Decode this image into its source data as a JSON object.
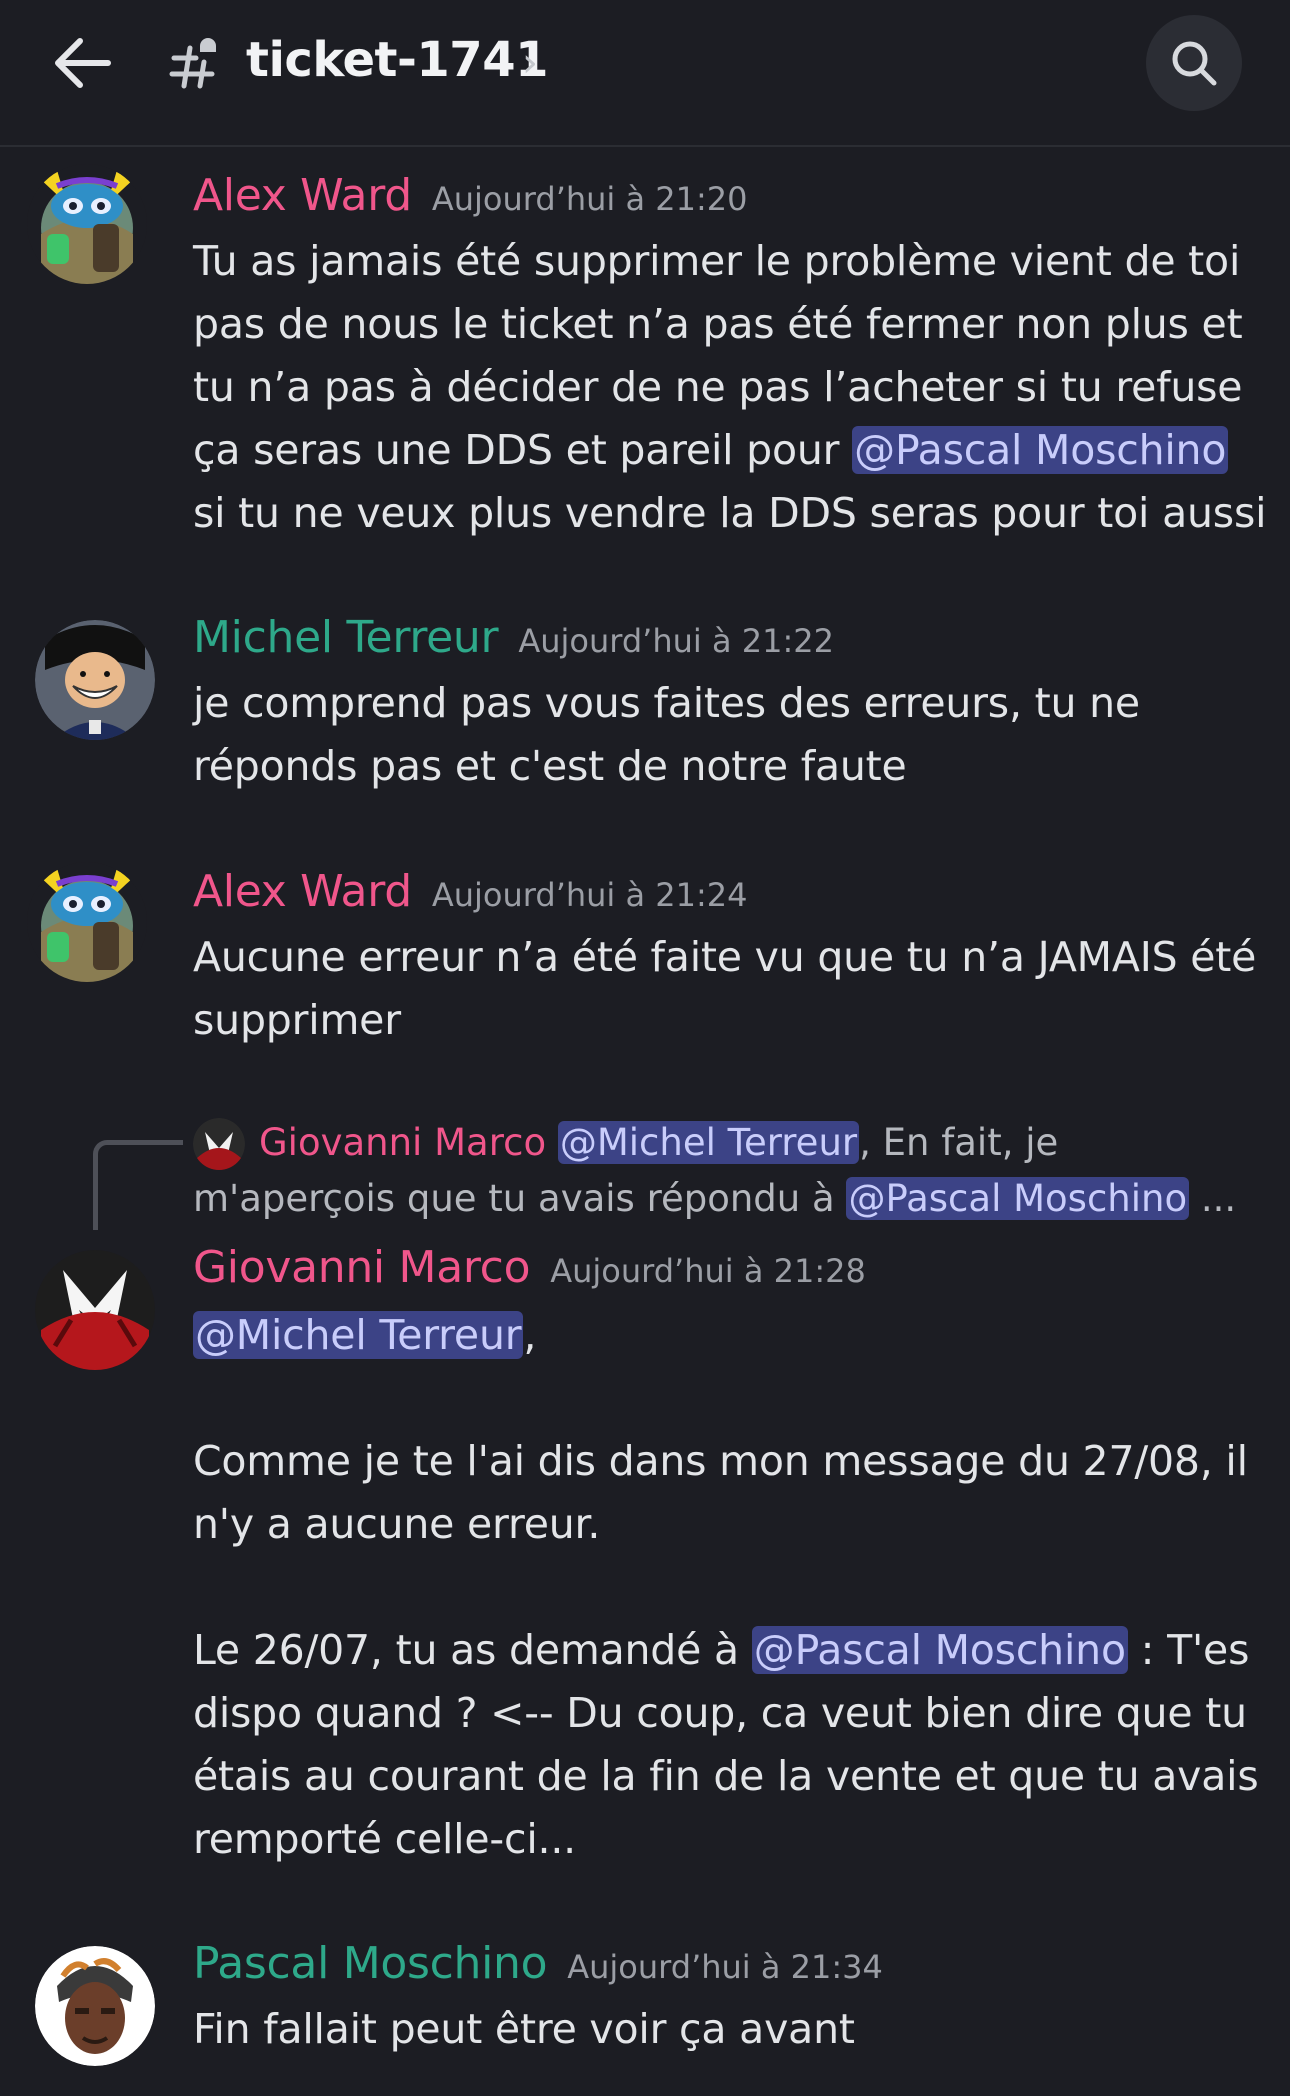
{
  "header": {
    "channel_name": "ticket-1741",
    "chevron": "›",
    "icons": {
      "back": "arrow-left-icon",
      "channel": "hashtag-thread-icon",
      "search": "search-icon"
    }
  },
  "messages": [
    {
      "author": "Alex Ward",
      "author_color": "#f0568b",
      "timestamp": "Aujourd’hui à 21:20",
      "lines": [
        "Tu as jamais été supprimer le problème vient de toi",
        "pas de nous le ticket n’a pas été fermer non plus et",
        "tu n’a pas à décider de ne pas l’acheter si tu refuse",
        "ça seras une DDS et pareil pour ",
        "si tu ne veux plus vendre la DDS seras pour toi aussi"
      ],
      "mention": "@Pascal Moschino"
    },
    {
      "author": "Michel Terreur",
      "author_color": "#2ea98a",
      "timestamp": "Aujourd’hui à 21:22",
      "lines": [
        "je comprend pas vous faites des erreurs, tu ne",
        "réponds pas et c'est de notre faute"
      ]
    },
    {
      "author": "Alex Ward",
      "author_color": "#f0568b",
      "timestamp": "Aujourd’hui à 21:24",
      "lines": [
        "Aucune erreur n’a été faite vu que tu n’a JAMAIS été",
        "supprimer"
      ]
    },
    {
      "reply": {
        "author": "Giovanni Marco",
        "mention1": "@Michel Terreur",
        "text1": ",  En fait, je",
        "text2": "m'aperçois que tu avais répondu à ",
        "mention2": "@Pascal Moschino",
        "ellipsis": " ..."
      },
      "author": "Giovanni Marco",
      "author_color": "#f0568b",
      "timestamp": "Aujourd’hui à 21:28",
      "mention_top": "@Michel Terreur",
      "comma": ",",
      "lines": [
        "Comme je te l'ai dis dans mon message du 27/08, il",
        "n'y a aucune erreur.",
        "Le 26/07, tu as demandé à ",
        " : T'es",
        "dispo quand ? <-- Du coup, ca veut bien dire que tu",
        "étais au courant de la fin de la vente et que tu avais",
        "remporté celle-ci..."
      ],
      "mention": "@Pascal Moschino"
    },
    {
      "author": "Pascal Moschino",
      "author_color": "#2ea98a",
      "timestamp": "Aujourd’hui à 21:34",
      "lines": [
        "Fin fallait peut être voir ça avant"
      ]
    }
  ]
}
